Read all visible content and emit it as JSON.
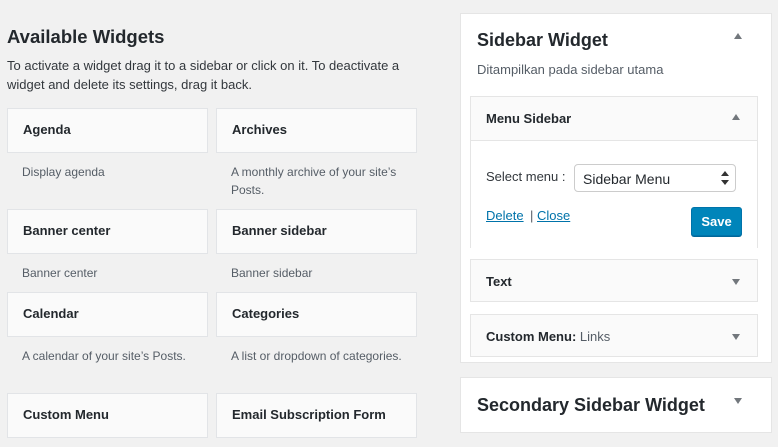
{
  "available": {
    "title": "Available Widgets",
    "description": "To activate a widget drag it to a sidebar or click on it. To deactivate a widget and delete its settings, drag it back.",
    "widgets": [
      {
        "title": "Agenda",
        "description": "Display agenda"
      },
      {
        "title": "Archives",
        "description": "A monthly archive of your site’s Posts."
      },
      {
        "title": "Banner center",
        "description": "Banner center"
      },
      {
        "title": "Banner sidebar",
        "description": "Banner sidebar"
      },
      {
        "title": "Calendar",
        "description": "A calendar of your site’s Posts."
      },
      {
        "title": "Categories",
        "description": "A list or dropdown of categories."
      },
      {
        "title": "Custom Menu",
        "description": ""
      },
      {
        "title": "Email Subscription Form",
        "description": ""
      }
    ]
  },
  "sidebar": {
    "title": "Sidebar Widget",
    "description": "Ditampilkan pada sidebar utama",
    "menu_widget": {
      "title": "Menu Sidebar",
      "select_label": "Select menu :",
      "selected_menu": "Sidebar Menu",
      "delete_label": "Delete",
      "separator": "|",
      "close_label": "Close",
      "save_label": "Save"
    },
    "text_widget": {
      "title": "Text"
    },
    "custom_menu_widget": {
      "title": "Custom Menu:",
      "subtitle": "Links"
    }
  },
  "secondary_sidebar": {
    "title": "Secondary Sidebar Widget"
  },
  "icons": {
    "collapse": "arrow-up-icon",
    "expand": "arrow-down-icon"
  }
}
